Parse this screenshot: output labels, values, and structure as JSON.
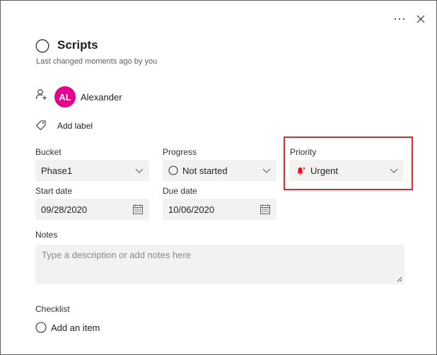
{
  "header": {
    "more_icon": "more-horizontal-icon",
    "close_icon": "close-icon"
  },
  "task": {
    "title": "Scripts",
    "changed_text": "Last changed moments ago by you"
  },
  "assignee": {
    "initials": "AL",
    "name": "Alexander",
    "avatar_color": "#e3008c"
  },
  "label": {
    "add_label": "Add label"
  },
  "fields": {
    "bucket": {
      "label": "Bucket",
      "value": "Phase1"
    },
    "progress": {
      "label": "Progress",
      "value": "Not started"
    },
    "priority": {
      "label": "Priority",
      "value": "Urgent",
      "icon_color": "#e81123"
    },
    "start_date": {
      "label": "Start date",
      "value": "09/28/2020"
    },
    "due_date": {
      "label": "Due date",
      "value": "10/06/2020"
    }
  },
  "notes": {
    "label": "Notes",
    "placeholder": "Type a description or add notes here"
  },
  "checklist": {
    "label": "Checklist",
    "add_item": "Add an item"
  },
  "highlight_color": "#e0292f"
}
